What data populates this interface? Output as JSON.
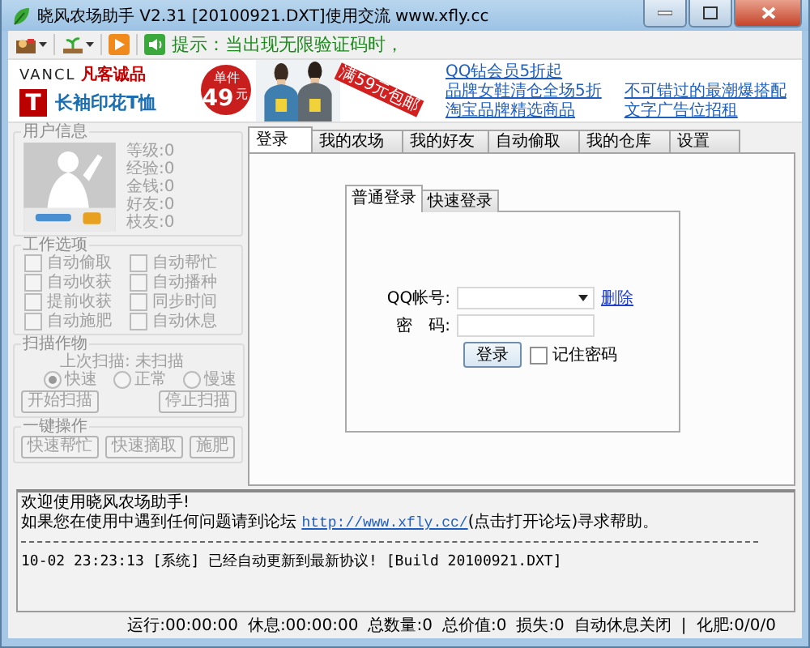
{
  "window": {
    "title": "晓风农场助手 V2.31 [20100921.DXT]使用交流 www.xfly.cc"
  },
  "toolbar": {
    "tip": "提示：当出现无限验证码时，"
  },
  "banner": {
    "brand": "VANCL",
    "brand_cn": "凡客诚品",
    "logo_letter": "T",
    "product": "长袖印花T恤",
    "price_label": "单件",
    "price": "49",
    "price_unit": "元",
    "ribbon": "满59元包邮"
  },
  "ad_links": [
    {
      "text": "QQ钻会员5折起"
    },
    {
      "text": "品牌女鞋清仓全场5折"
    },
    {
      "text": "不可错过的最潮爆搭配"
    },
    {
      "text": "淘宝品牌精选商品"
    },
    {
      "text": "文字广告位招租"
    }
  ],
  "user_info": {
    "title": "用户信息",
    "stats": [
      "等级:0",
      "经验:0",
      "金钱:0",
      "好友:0",
      "枝友:0"
    ]
  },
  "work_options": {
    "title": "工作选项",
    "items": [
      {
        "label": "自动偷取",
        "checked": false,
        "disabled": true
      },
      {
        "label": "自动帮忙",
        "checked": false,
        "disabled": true
      },
      {
        "label": "自动收获",
        "checked": false,
        "disabled": true
      },
      {
        "label": "自动播种",
        "checked": false,
        "disabled": true
      },
      {
        "label": "提前收获",
        "checked": false,
        "disabled": true
      },
      {
        "label": "同步时间",
        "checked": false,
        "disabled": true
      },
      {
        "label": "自动施肥",
        "checked": false,
        "disabled": true
      },
      {
        "label": "自动休息",
        "checked": false,
        "disabled": true
      }
    ]
  },
  "scan": {
    "title": "扫描作物",
    "last_scan": "上次扫描: 未扫描",
    "speeds": [
      {
        "label": "快速",
        "selected": true,
        "disabled": true
      },
      {
        "label": "正常",
        "selected": false,
        "disabled": true
      },
      {
        "label": "慢速",
        "selected": false,
        "disabled": true
      }
    ],
    "buttons": [
      {
        "label": "开始扫描",
        "disabled": true
      },
      {
        "label": "停止扫描",
        "disabled": true
      }
    ]
  },
  "quick_actions": {
    "title": "一键操作",
    "buttons": [
      {
        "label": "快速帮忙",
        "disabled": true
      },
      {
        "label": "快速摘取",
        "disabled": true
      },
      {
        "label": "施肥",
        "disabled": true
      }
    ]
  },
  "tabs": [
    {
      "label": "登录",
      "selected": true
    },
    {
      "label": "我的农场",
      "selected": false
    },
    {
      "label": "我的好友",
      "selected": false
    },
    {
      "label": "自动偷取",
      "selected": false
    },
    {
      "label": "我的仓库",
      "selected": false
    },
    {
      "label": "设置",
      "selected": false
    }
  ],
  "login": {
    "tabs": [
      {
        "label": "普通登录",
        "selected": true
      },
      {
        "label": "快速登录",
        "selected": false
      }
    ],
    "account_label": "QQ帐号:",
    "delete_link": "删除",
    "password_label": "密　码:",
    "login_button": "登录",
    "remember": {
      "label": "记住密码",
      "checked": false
    }
  },
  "log": {
    "lines": [
      {
        "kind": "text",
        "text": "欢迎使用晓风农场助手!"
      },
      {
        "kind": "link",
        "before": "如果您在使用中遇到任何问题请到论坛 ",
        "link": "http://www.xfly.cc/",
        "after": "(点击打开论坛)寻求帮助。"
      },
      {
        "kind": "rule"
      },
      {
        "kind": "text",
        "text": "10-02 23:23:13 [系统] 已经自动更新到最新协议!  [Build 20100921.DXT]"
      }
    ]
  },
  "status_bar": [
    "运行:00:00:00",
    "休息:00:00:00",
    "总数量:0",
    "总价值:0",
    "损失:0",
    "自动休息关闭",
    "|",
    "化肥:0/0/0"
  ]
}
